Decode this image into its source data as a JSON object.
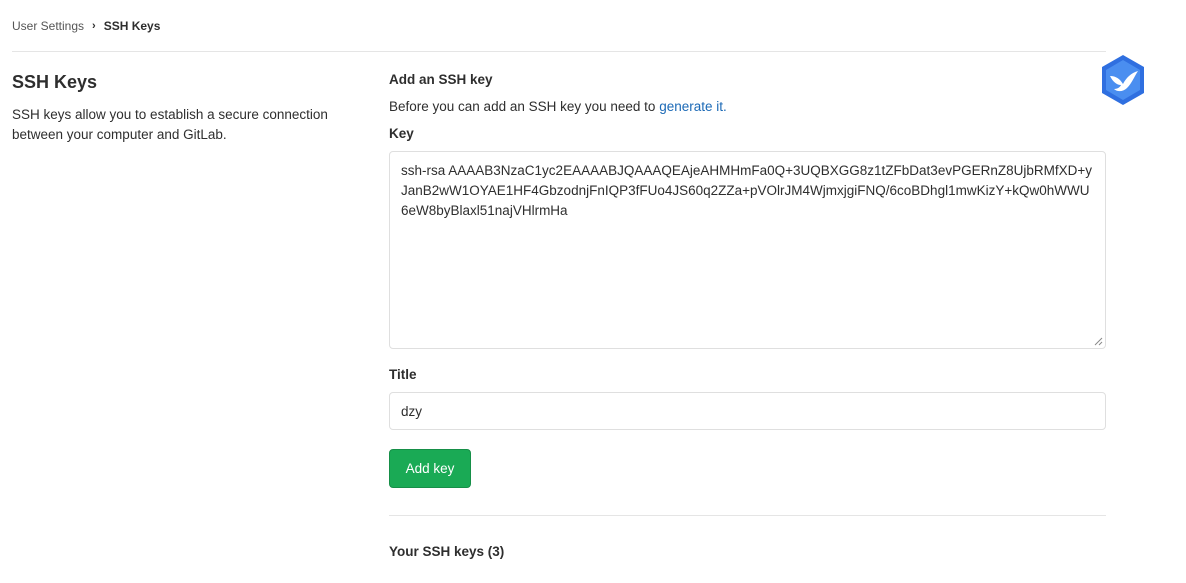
{
  "breadcrumb": {
    "parent": "User Settings",
    "separator": "›",
    "current": "SSH Keys"
  },
  "intro": {
    "title": "SSH Keys",
    "description": "SSH keys allow you to establish a secure connection between your computer and GitLab."
  },
  "form": {
    "heading": "Add an SSH key",
    "help_prefix": "Before you can add an SSH key you need to ",
    "help_link": "generate it.",
    "key_label": "Key",
    "key_value": "ssh-rsa AAAAB3NzaC1yc2EAAAABJQAAAQEAjeAHMHmFa0Q+3UQBXGG8z1tZFbDat3evPGERnZ8UjbRMfXD+yJanB2wW1OYAE1HF4GbzodnjFnIQP3fFUo4JS60q2ZZa+pVOlrJM4WjmxjgiFNQ/6coBDhgl1mwKizY+kQw0hWWU6eW8byBlaxl51najVHlrmHa",
    "title_label": "Title",
    "title_value": "dzy",
    "submit_label": "Add key"
  },
  "keys_list": {
    "heading": "Your SSH keys (3)"
  },
  "colors": {
    "primary_button": "#1aaa55",
    "link": "#1b69b6",
    "badge": "#4a8ef0"
  },
  "icons": {
    "badge": "bird-shield-icon",
    "resize": "resize-grip-icon"
  }
}
